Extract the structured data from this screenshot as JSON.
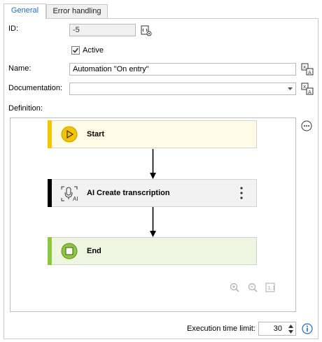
{
  "tabs": {
    "general": "General",
    "error_handling": "Error handling"
  },
  "fields": {
    "id_label": "ID:",
    "id_value": "-5",
    "active_label": "Active",
    "active_checked": true,
    "name_label": "Name:",
    "name_value": "Automation \"On entry\"",
    "documentation_label": "Documentation:",
    "documentation_value": "",
    "definition_label": "Definition:"
  },
  "flow": {
    "start": {
      "label": "Start",
      "accent": "#f5c400",
      "fill": "#fffbe6"
    },
    "action": {
      "label": "AI Create transcription",
      "icon_text": "AI",
      "accent": "#000000",
      "fill": "#f2f2f2"
    },
    "end": {
      "label": "End",
      "accent": "#8dc63f",
      "fill": "#eef5e1"
    }
  },
  "footer": {
    "timeout_label": "Execution time limit:",
    "timeout_value": "30"
  },
  "colors": {
    "tab_active_text": "#1e6fc2",
    "info": "#1e6fc2"
  },
  "icons": [
    "settings-id-icon",
    "translate-icon",
    "more-icon",
    "zoom-in-icon",
    "zoom-out-icon",
    "fit-icon",
    "info-icon",
    "play-icon",
    "stop-icon",
    "microphone-ai-icon",
    "kebab-icon"
  ]
}
